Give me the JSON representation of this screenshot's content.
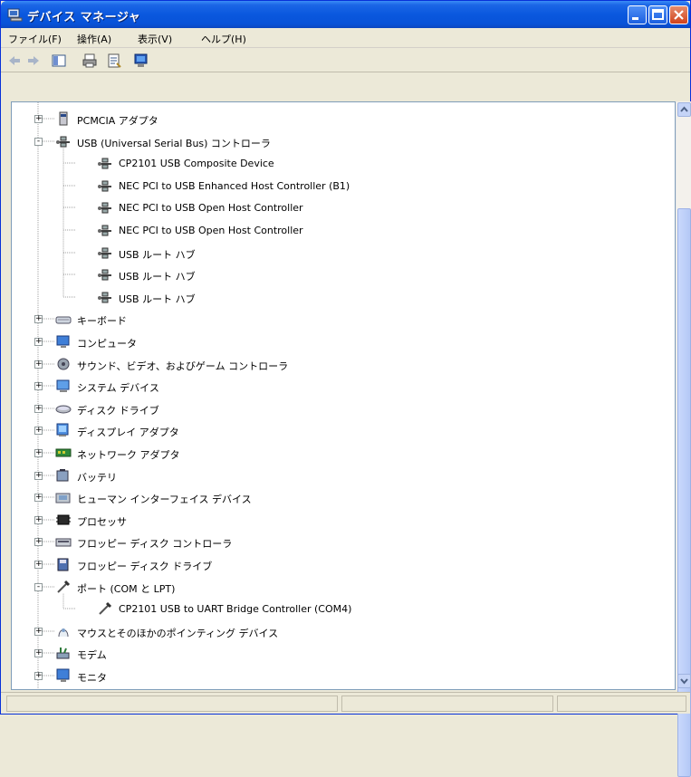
{
  "window": {
    "title": "デバイス マネージャ"
  },
  "menu": [
    "ファイル(F)",
    "操作(A)",
    "表示(V)",
    "ヘルプ(H)"
  ],
  "tree": [
    {
      "label": "PCMCIA アダプタ",
      "level": 0,
      "expander": "+",
      "icon": "pcmcia-icon"
    },
    {
      "label": "USB (Universal Serial Bus) コントローラ",
      "level": 0,
      "expander": "-",
      "icon": "usb-icon"
    },
    {
      "label": "CP2101 USB Composite Device",
      "level": 1,
      "icon": "usb-icon"
    },
    {
      "label": "NEC PCI to USB Enhanced Host Controller (B1)",
      "level": 1,
      "icon": "usb-icon"
    },
    {
      "label": "NEC PCI to USB Open Host Controller",
      "level": 1,
      "icon": "usb-icon"
    },
    {
      "label": "NEC PCI to USB Open Host Controller",
      "level": 1,
      "icon": "usb-icon"
    },
    {
      "label": "USB ルート ハブ",
      "level": 1,
      "icon": "usb-icon"
    },
    {
      "label": "USB ルート ハブ",
      "level": 1,
      "icon": "usb-icon"
    },
    {
      "label": "USB ルート ハブ",
      "level": 1,
      "icon": "usb-icon"
    },
    {
      "label": "キーボード",
      "level": 0,
      "expander": "+",
      "icon": "keyboard-icon"
    },
    {
      "label": "コンピュータ",
      "level": 0,
      "expander": "+",
      "icon": "computer-icon"
    },
    {
      "label": "サウンド、ビデオ、およびゲーム コントローラ",
      "level": 0,
      "expander": "+",
      "icon": "sound-icon"
    },
    {
      "label": "システム デバイス",
      "level": 0,
      "expander": "+",
      "icon": "system-icon"
    },
    {
      "label": "ディスク ドライブ",
      "level": 0,
      "expander": "+",
      "icon": "disk-icon"
    },
    {
      "label": "ディスプレイ アダプタ",
      "level": 0,
      "expander": "+",
      "icon": "display-icon"
    },
    {
      "label": "ネットワーク アダプタ",
      "level": 0,
      "expander": "+",
      "icon": "network-icon"
    },
    {
      "label": "バッテリ",
      "level": 0,
      "expander": "+",
      "icon": "battery-icon"
    },
    {
      "label": "ヒューマン インターフェイス デバイス",
      "level": 0,
      "expander": "+",
      "icon": "hid-icon"
    },
    {
      "label": "プロセッサ",
      "level": 0,
      "expander": "+",
      "icon": "processor-icon"
    },
    {
      "label": "フロッピー ディスク コントローラ",
      "level": 0,
      "expander": "+",
      "icon": "floppy-controller-icon"
    },
    {
      "label": "フロッピー ディスク ドライブ",
      "level": 0,
      "expander": "+",
      "icon": "floppy-drive-icon"
    },
    {
      "label": "ポート (COM と LPT)",
      "level": 0,
      "expander": "-",
      "icon": "port-icon"
    },
    {
      "label": "CP2101 USB to UART Bridge Controller (COM4)",
      "level": 1,
      "icon": "port-icon"
    },
    {
      "label": "マウスとそのほかのポインティング デバイス",
      "level": 0,
      "expander": "+",
      "icon": "mouse-icon"
    },
    {
      "label": "モデム",
      "level": 0,
      "expander": "+",
      "icon": "modem-icon"
    },
    {
      "label": "モニタ",
      "level": 0,
      "expander": "+",
      "icon": "monitor-icon"
    }
  ],
  "colors": {
    "titlebar": "#0a58de",
    "close": "#d0421b"
  }
}
